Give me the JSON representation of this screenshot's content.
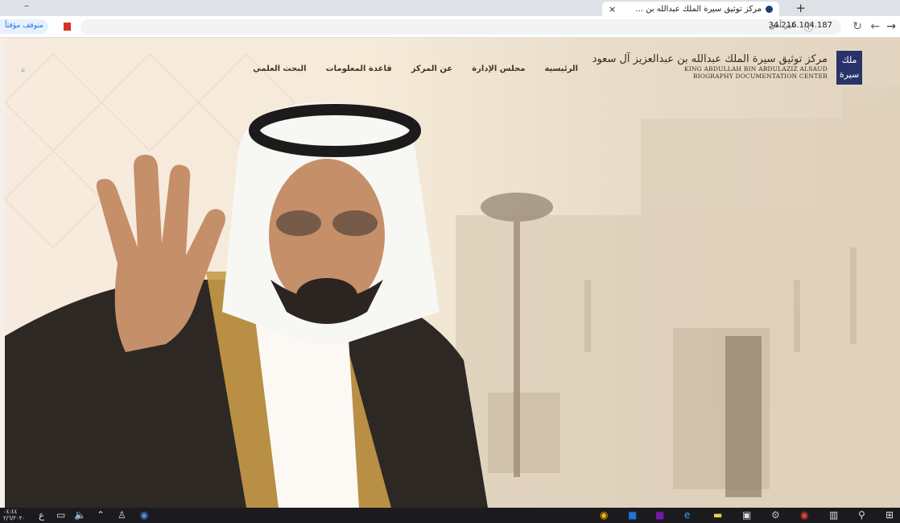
{
  "browser": {
    "tab_title": "مركز توثيق سيرة الملك عبدالله بن ...",
    "tab_close": "×",
    "new_tab": "+",
    "minimize": "–",
    "url": "34.216.104.187",
    "security_label": "غير آمن",
    "profile_paused": "متوقف مؤقتاً",
    "icons": [
      "back-icon",
      "forward-icon",
      "reload-icon",
      "info-icon",
      "star-icon",
      "bookmark-icon"
    ]
  },
  "site": {
    "logo_box": "ملك\nسيرة",
    "logo_arabic": "مركز توثيق سيرة الملك عبدالله بن عبدالعزيز آل سعود",
    "logo_english_1": "KING ABDULLAH BIN ABDULAZIZ ALSAUD",
    "logo_english_2": "BIOGRAPHY DOCUMENTATION CENTER",
    "nav": [
      "الرئيسية",
      "مجلس الإدارة",
      "عن المركز",
      "قاعدة المعلومات",
      "البحث العلمي"
    ],
    "search_icon": "⌕"
  },
  "taskbar": {
    "clock_time": "٠٤:٤٤",
    "clock_date": "٢/٦/٢٠٢٠",
    "lang": "ع",
    "icons": [
      "chrome-icon",
      "outlook-icon",
      "onenote-icon",
      "edge-icon",
      "explorer-icon",
      "store-icon",
      "settings-icon",
      "chrome-app-icon",
      "task-view-icon",
      "search-icon",
      "windows-icon"
    ]
  },
  "colors": {
    "accent": "#28336a",
    "text": "#473624",
    "taskbar": "#1b1b1f"
  }
}
